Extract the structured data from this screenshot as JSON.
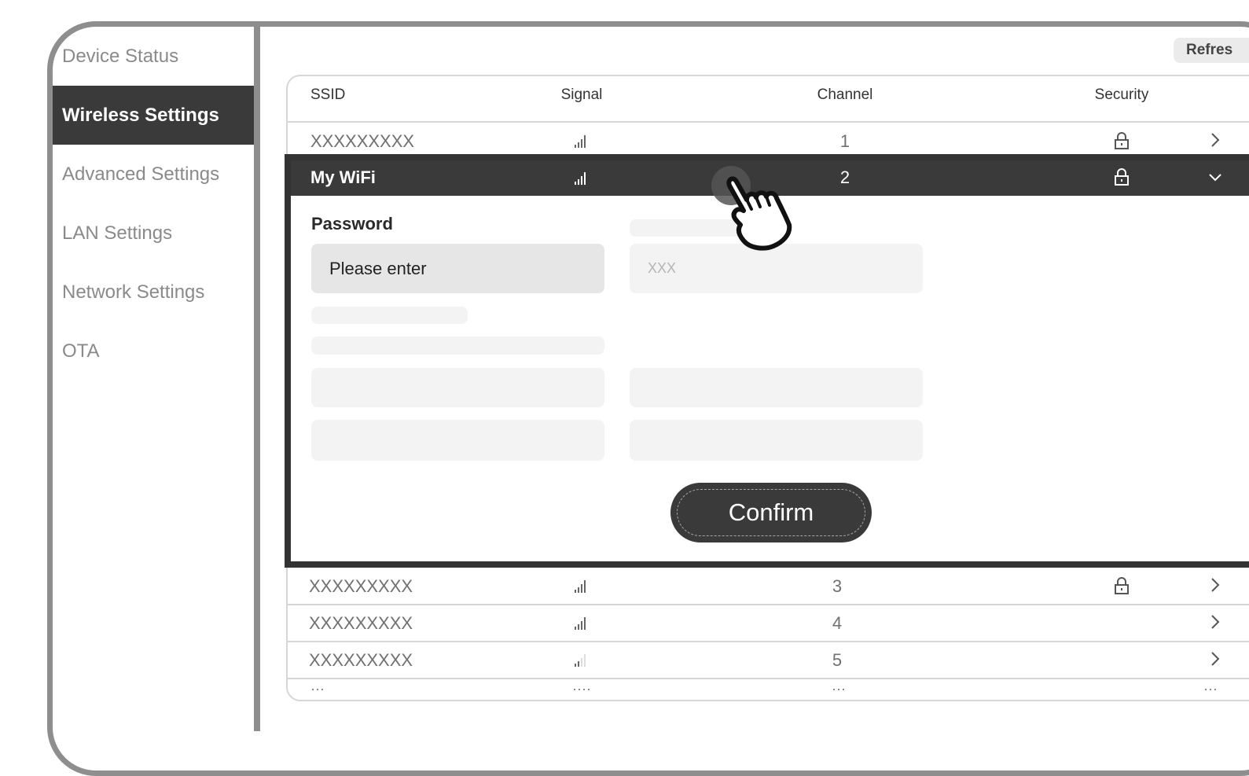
{
  "sidebar": {
    "items": [
      {
        "label": "Device Status",
        "active": false
      },
      {
        "label": "Wireless Settings",
        "active": true
      },
      {
        "label": "Advanced Settings",
        "active": false
      },
      {
        "label": "LAN Settings",
        "active": false
      },
      {
        "label": "Network Settings",
        "active": false
      },
      {
        "label": "OTA",
        "active": false
      }
    ]
  },
  "toolbar": {
    "refresh_label": "Refres"
  },
  "table": {
    "headers": {
      "ssid": "SSID",
      "signal": "Signal",
      "channel": "Channel",
      "security": "Security"
    },
    "rows": [
      {
        "ssid": "XXXXXXXXX",
        "channel": "1",
        "signal_bars": 4,
        "secured": true
      },
      {
        "ssid": "My WiFi",
        "channel": "2",
        "signal_bars": 4,
        "secured": true,
        "expanded": true
      },
      {
        "ssid": "XXXXXXXXX",
        "channel": "3",
        "signal_bars": 4,
        "secured": true
      },
      {
        "ssid": "XXXXXXXXX",
        "channel": "4",
        "signal_bars": 4,
        "secured": false
      },
      {
        "ssid": "XXXXXXXXX",
        "channel": "5",
        "signal_bars": 2,
        "secured": false
      }
    ],
    "more": {
      "ssid": "···",
      "signal": "····",
      "channel": "···",
      "chevron": "···"
    }
  },
  "expanded": {
    "password_label": "Password",
    "password_placeholder": "Please enter",
    "second_placeholder": "XXX",
    "confirm_label": "Confirm"
  },
  "icons": {
    "signal": "signal-bars-icon",
    "lock": "lock-icon",
    "chevron_right": "chevron-right-icon",
    "chevron_down": "chevron-down-icon",
    "cursor": "hand-pointer-icon"
  },
  "colors": {
    "active": "#3a3a3a",
    "frame": "#8e8e8e",
    "muted": "#8a8a8a"
  }
}
